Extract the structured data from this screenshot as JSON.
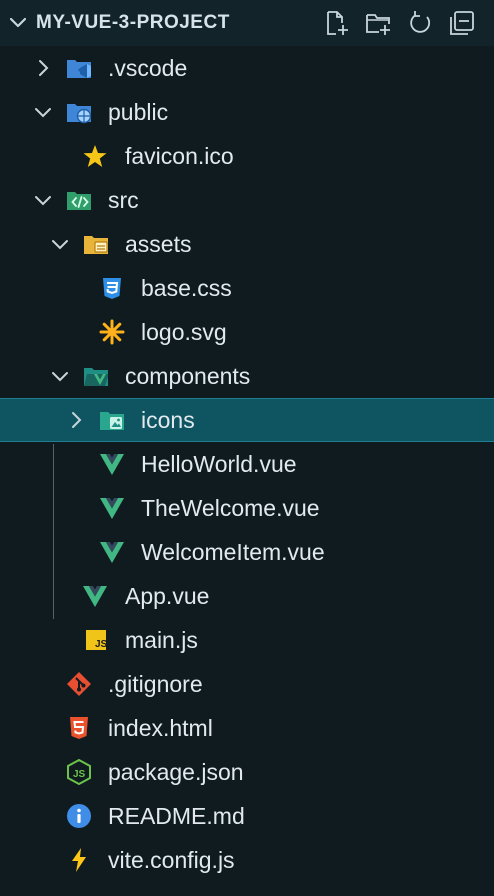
{
  "explorer": {
    "title": "MY-VUE-3-PROJECT",
    "actions": [
      {
        "name": "new-file-icon"
      },
      {
        "name": "new-folder-icon"
      },
      {
        "name": "refresh-icon"
      },
      {
        "name": "collapse-all-icon"
      }
    ]
  },
  "tree": [
    {
      "label": ".vscode",
      "icon": "vscode-folder-icon",
      "type": "folder",
      "expanded": false
    },
    {
      "label": "public",
      "icon": "public-folder-icon",
      "type": "folder",
      "expanded": true
    },
    {
      "label": "favicon.ico",
      "icon": "star-icon",
      "type": "file"
    },
    {
      "label": "src",
      "icon": "src-folder-icon",
      "type": "folder",
      "expanded": true
    },
    {
      "label": "assets",
      "icon": "assets-folder-icon",
      "type": "folder",
      "expanded": true
    },
    {
      "label": "base.css",
      "icon": "css-icon",
      "type": "file"
    },
    {
      "label": "logo.svg",
      "icon": "svg-icon",
      "type": "file"
    },
    {
      "label": "components",
      "icon": "components-folder-icon",
      "type": "folder",
      "expanded": true
    },
    {
      "label": "icons",
      "icon": "icons-folder-icon",
      "type": "folder",
      "expanded": false,
      "selected": true
    },
    {
      "label": "HelloWorld.vue",
      "icon": "vue-icon",
      "type": "file"
    },
    {
      "label": "TheWelcome.vue",
      "icon": "vue-icon",
      "type": "file"
    },
    {
      "label": "WelcomeItem.vue",
      "icon": "vue-icon",
      "type": "file"
    },
    {
      "label": "App.vue",
      "icon": "vue-icon",
      "type": "file"
    },
    {
      "label": "main.js",
      "icon": "js-icon",
      "type": "file"
    },
    {
      "label": ".gitignore",
      "icon": "git-icon",
      "type": "file"
    },
    {
      "label": "index.html",
      "icon": "html-icon",
      "type": "file"
    },
    {
      "label": "package.json",
      "icon": "nodejs-icon",
      "type": "file"
    },
    {
      "label": "README.md",
      "icon": "info-icon",
      "type": "file"
    },
    {
      "label": "vite.config.js",
      "icon": "vite-icon",
      "type": "file"
    }
  ],
  "colors": {
    "background": "#0f1b1f",
    "header": "#12232a",
    "selection": "#0e5561",
    "vue": "#41b883",
    "folder_blue": "#3f86d6",
    "folder_green": "#2f9e6a",
    "folder_yellow": "#e8b43a",
    "folder_teal": "#1f8f85"
  }
}
